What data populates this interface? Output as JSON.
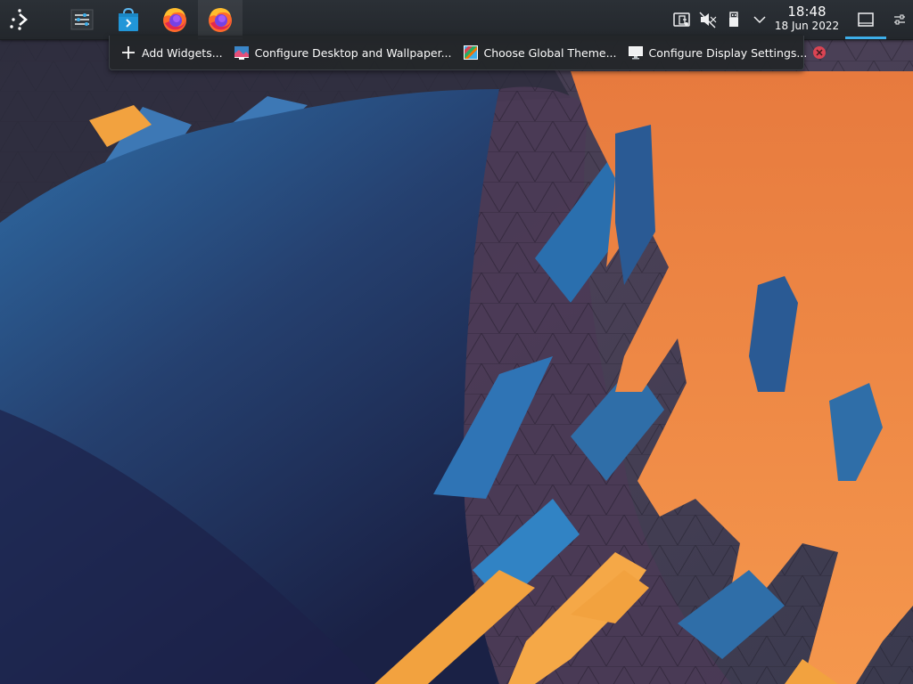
{
  "panel": {
    "launcher": {
      "icon": "kde-launcher-icon"
    },
    "tasks": [
      {
        "name": "tweaks",
        "icon": "settings-sliders-icon"
      },
      {
        "name": "discover",
        "icon": "discover-store-icon"
      },
      {
        "name": "firefox",
        "icon": "firefox-icon"
      },
      {
        "name": "firefox",
        "icon": "firefox-icon",
        "active": true
      }
    ],
    "tray": {
      "icons": [
        "kdeconnect-icon",
        "volume-muted-icon",
        "usb-drive-icon",
        "chevron-down-icon"
      ]
    },
    "clock": {
      "time": "18:48",
      "date": "18 Jun 2022"
    },
    "show_desktop_icon": "show-desktop-icon",
    "settings_icon": "panel-settings-icon",
    "accent": "#3daee9"
  },
  "toolbox": {
    "items": [
      {
        "label": "Add Widgets...",
        "icon": "plus-icon"
      },
      {
        "label": "Configure Desktop and Wallpaper...",
        "icon": "desktop-wallpaper-icon"
      },
      {
        "label": "Choose Global Theme...",
        "icon": "global-theme-icon"
      },
      {
        "label": "Configure Display Settings...",
        "icon": "display-icon"
      }
    ],
    "close_icon": "close-icon",
    "close_color": "#da4453"
  }
}
